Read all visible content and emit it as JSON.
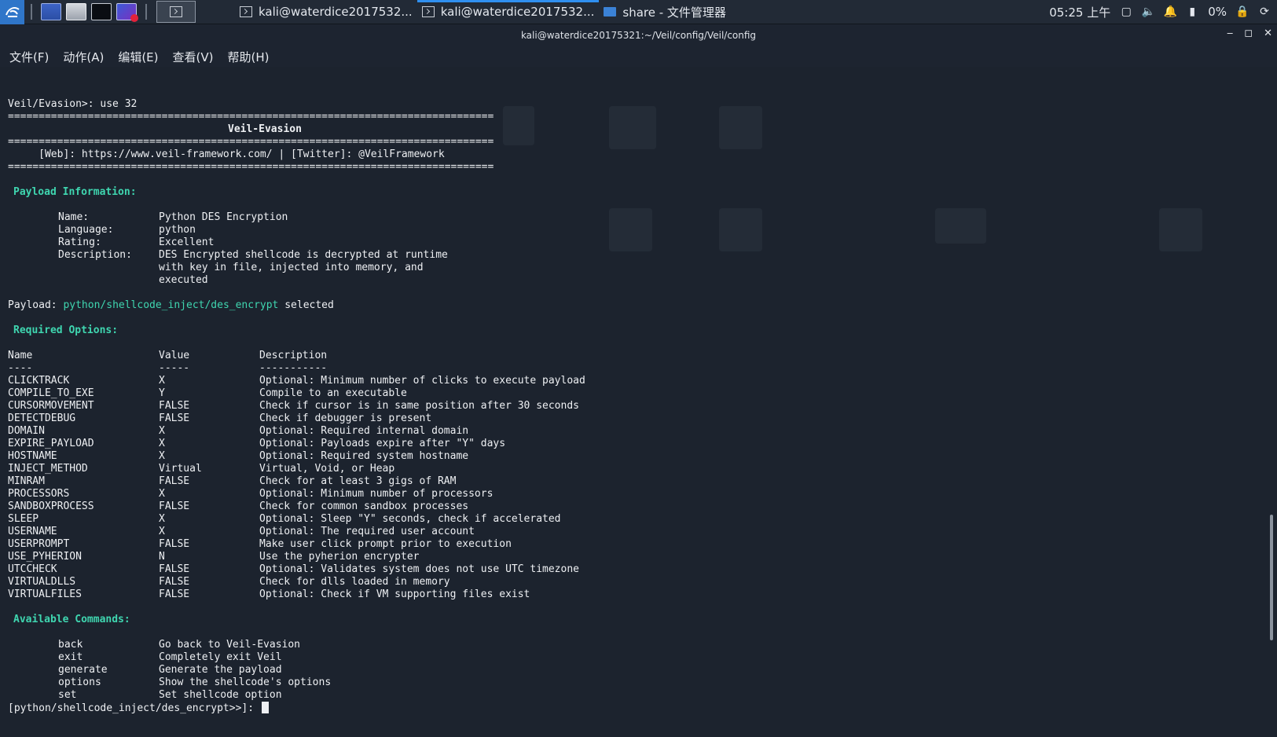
{
  "taskbar": {
    "tasks": [
      {
        "label": "kali@waterdice2017532..."
      },
      {
        "label": "kali@waterdice2017532..."
      },
      {
        "label": "share - 文件管理器"
      }
    ],
    "time": "05:25 上午",
    "battery": "0%"
  },
  "window": {
    "title": "kali@waterdice20175321:~/Veil/config/Veil/config"
  },
  "menu": [
    "文件(F)",
    "动作(A)",
    "编辑(E)",
    "查看(V)",
    "帮助(H)"
  ],
  "terminal": {
    "command_line": "Veil/Evasion>: use 32",
    "rule": "===============================================================================",
    "banner_title": "Veil-Evasion",
    "banner_links": "     [Web]: https://www.veil-framework.com/ | [Twitter]: @VeilFramework",
    "payload_info_header": "Payload Information:",
    "info": {
      "name_label": "Name:",
      "name_value": "Python DES Encryption",
      "language_label": "Language:",
      "language_value": "python",
      "rating_label": "Rating:",
      "rating_value": "Excellent",
      "description_label": "Description:",
      "description_lines": [
        "DES Encrypted shellcode is decrypted at runtime",
        "with key in file, injected into memory, and",
        "executed"
      ]
    },
    "payload_prefix": "Payload: ",
    "payload_path": "python/shellcode_inject/des_encrypt",
    "payload_suffix": " selected",
    "required_header": "Required Options:",
    "options_headers": {
      "name": "Name",
      "value": "Value",
      "description": "Description"
    },
    "options_underlines": {
      "name": "----",
      "value": "-----",
      "description": "-----------"
    },
    "options": [
      {
        "name": "CLICKTRACK",
        "value": "X",
        "description": "Optional: Minimum number of clicks to execute payload"
      },
      {
        "name": "COMPILE_TO_EXE",
        "value": "Y",
        "description": "Compile to an executable"
      },
      {
        "name": "CURSORMOVEMENT",
        "value": "FALSE",
        "description": "Check if cursor is in same position after 30 seconds"
      },
      {
        "name": "DETECTDEBUG",
        "value": "FALSE",
        "description": "Check if debugger is present"
      },
      {
        "name": "DOMAIN",
        "value": "X",
        "description": "Optional: Required internal domain"
      },
      {
        "name": "EXPIRE_PAYLOAD",
        "value": "X",
        "description": "Optional: Payloads expire after \"Y\" days"
      },
      {
        "name": "HOSTNAME",
        "value": "X",
        "description": "Optional: Required system hostname"
      },
      {
        "name": "INJECT_METHOD",
        "value": "Virtual",
        "description": "Virtual, Void, or Heap"
      },
      {
        "name": "MINRAM",
        "value": "FALSE",
        "description": "Check for at least 3 gigs of RAM"
      },
      {
        "name": "PROCESSORS",
        "value": "X",
        "description": "Optional: Minimum number of processors"
      },
      {
        "name": "SANDBOXPROCESS",
        "value": "FALSE",
        "description": "Check for common sandbox processes"
      },
      {
        "name": "SLEEP",
        "value": "X",
        "description": "Optional: Sleep \"Y\" seconds, check if accelerated"
      },
      {
        "name": "USERNAME",
        "value": "X",
        "description": "Optional: The required user account"
      },
      {
        "name": "USERPROMPT",
        "value": "FALSE",
        "description": "Make user click prompt prior to execution"
      },
      {
        "name": "USE_PYHERION",
        "value": "N",
        "description": "Use the pyherion encrypter"
      },
      {
        "name": "UTCCHECK",
        "value": "FALSE",
        "description": "Optional: Validates system does not use UTC timezone"
      },
      {
        "name": "VIRTUALDLLS",
        "value": "FALSE",
        "description": "Check for dlls loaded in memory"
      },
      {
        "name": "VIRTUALFILES",
        "value": "FALSE",
        "description": "Optional: Check if VM supporting files exist"
      }
    ],
    "commands_header": "Available Commands:",
    "commands": [
      {
        "name": "back",
        "description": "Go back to Veil-Evasion"
      },
      {
        "name": "exit",
        "description": "Completely exit Veil"
      },
      {
        "name": "generate",
        "description": "Generate the payload"
      },
      {
        "name": "options",
        "description": "Show the shellcode's options"
      },
      {
        "name": "set",
        "description": "Set shellcode option"
      }
    ],
    "prompt": "[python/shellcode_inject/des_encrypt>>]: "
  }
}
